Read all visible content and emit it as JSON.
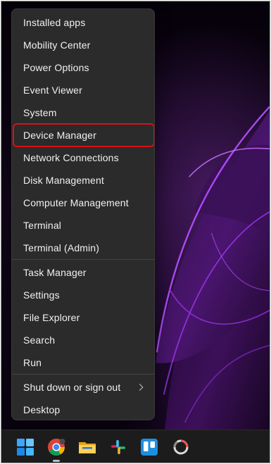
{
  "context_menu": {
    "items": [
      {
        "label": "Installed apps"
      },
      {
        "label": "Mobility Center"
      },
      {
        "label": "Power Options"
      },
      {
        "label": "Event Viewer"
      },
      {
        "label": "System"
      },
      {
        "label": "Device Manager",
        "highlighted": true
      },
      {
        "label": "Network Connections"
      },
      {
        "label": "Disk Management"
      },
      {
        "label": "Computer Management"
      },
      {
        "label": "Terminal"
      },
      {
        "label": "Terminal (Admin)"
      },
      {
        "label": "Task Manager"
      },
      {
        "label": "Settings"
      },
      {
        "label": "File Explorer"
      },
      {
        "label": "Search"
      },
      {
        "label": "Run"
      },
      {
        "label": "Shut down or sign out",
        "submenu": true
      },
      {
        "label": "Desktop"
      }
    ]
  },
  "taskbar": {
    "apps": [
      {
        "icon": "windows-start-icon"
      },
      {
        "icon": "chrome-icon",
        "running": true
      },
      {
        "icon": "file-explorer-icon"
      },
      {
        "icon": "slack-icon"
      },
      {
        "icon": "trello-icon"
      },
      {
        "icon": "ring-app-icon"
      }
    ]
  },
  "colors": {
    "menu_background": "#2b2b2b",
    "highlight_border": "#d90f16",
    "taskbar_background": "#1c1c1c"
  }
}
